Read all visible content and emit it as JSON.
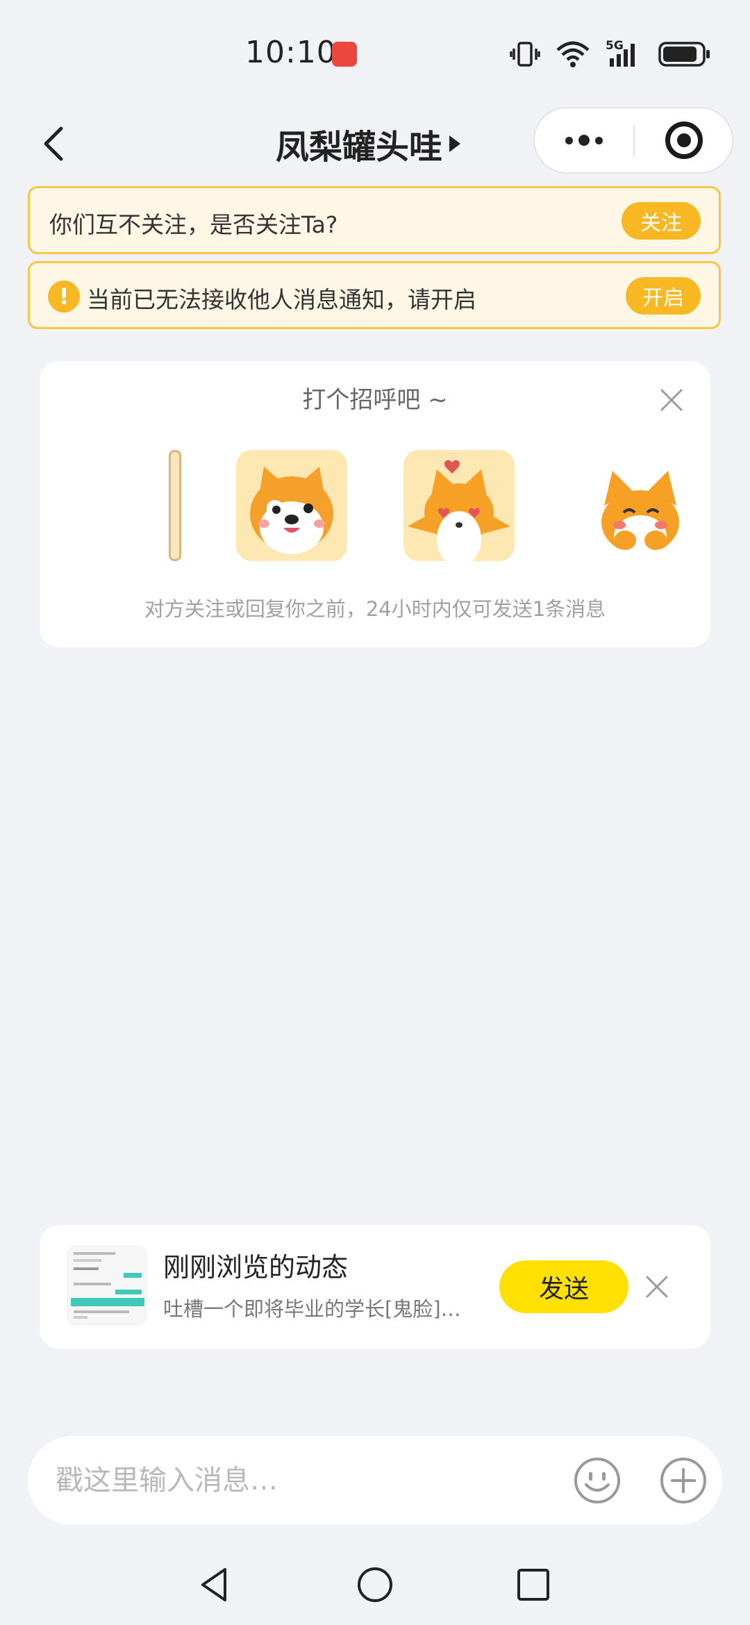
{
  "status_bar": {
    "time": "10:10",
    "app_icon": "huawei-appgallery-icon",
    "network": "5G",
    "icons": [
      "vibrate-icon",
      "wifi-icon",
      "signal-icon",
      "battery-icon"
    ]
  },
  "header": {
    "title": "凤梨罐头哇",
    "back_icon": "back-arrow-icon",
    "more_icon": "more-dots-icon",
    "close_icon": "target-close-icon"
  },
  "follow_banner": {
    "text": "你们互不关注，是否关注Ta?",
    "button": "关注"
  },
  "notify_banner": {
    "icon": "warning-icon",
    "icon_glyph": "!",
    "text": "当前已无法接收他人消息通知，请开启",
    "button": "开启"
  },
  "greeting_card": {
    "title": "打个招呼吧 ~",
    "stickers": [
      "shiba-sticker",
      "fox-hearts-sticker",
      "fox-blush-sticker"
    ],
    "hint": "对方关注或回复你之前，24小时内仅可发送1条消息"
  },
  "recent_post": {
    "title": "刚刚浏览的动态",
    "subtitle": "吐槽一个即将毕业的学长[鬼脸]…",
    "send_button": "发送"
  },
  "composer": {
    "placeholder": "戳这里输入消息…",
    "value": "",
    "emoji_icon": "emoji-icon",
    "plus_icon": "plus-icon"
  },
  "system_nav": [
    "back-triangle-icon",
    "home-circle-icon",
    "recents-square-icon"
  ],
  "colors": {
    "background": "#f1f2f6",
    "banner_bg": "#fff7e6",
    "banner_border": "#f7c645",
    "accent_orange": "#f7b824",
    "send_yellow": "#ffe000"
  }
}
